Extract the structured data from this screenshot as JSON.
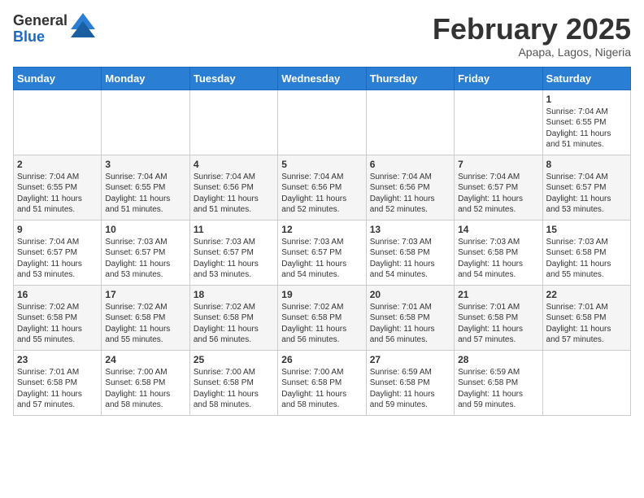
{
  "header": {
    "logo_general": "General",
    "logo_blue": "Blue",
    "month_title": "February 2025",
    "subtitle": "Apapa, Lagos, Nigeria"
  },
  "weekdays": [
    "Sunday",
    "Monday",
    "Tuesday",
    "Wednesday",
    "Thursday",
    "Friday",
    "Saturday"
  ],
  "weeks": [
    [
      {
        "day": "",
        "info": ""
      },
      {
        "day": "",
        "info": ""
      },
      {
        "day": "",
        "info": ""
      },
      {
        "day": "",
        "info": ""
      },
      {
        "day": "",
        "info": ""
      },
      {
        "day": "",
        "info": ""
      },
      {
        "day": "1",
        "info": "Sunrise: 7:04 AM\nSunset: 6:55 PM\nDaylight: 11 hours\nand 51 minutes."
      }
    ],
    [
      {
        "day": "2",
        "info": "Sunrise: 7:04 AM\nSunset: 6:55 PM\nDaylight: 11 hours\nand 51 minutes."
      },
      {
        "day": "3",
        "info": "Sunrise: 7:04 AM\nSunset: 6:55 PM\nDaylight: 11 hours\nand 51 minutes."
      },
      {
        "day": "4",
        "info": "Sunrise: 7:04 AM\nSunset: 6:56 PM\nDaylight: 11 hours\nand 51 minutes."
      },
      {
        "day": "5",
        "info": "Sunrise: 7:04 AM\nSunset: 6:56 PM\nDaylight: 11 hours\nand 52 minutes."
      },
      {
        "day": "6",
        "info": "Sunrise: 7:04 AM\nSunset: 6:56 PM\nDaylight: 11 hours\nand 52 minutes."
      },
      {
        "day": "7",
        "info": "Sunrise: 7:04 AM\nSunset: 6:57 PM\nDaylight: 11 hours\nand 52 minutes."
      },
      {
        "day": "8",
        "info": "Sunrise: 7:04 AM\nSunset: 6:57 PM\nDaylight: 11 hours\nand 53 minutes."
      }
    ],
    [
      {
        "day": "9",
        "info": "Sunrise: 7:04 AM\nSunset: 6:57 PM\nDaylight: 11 hours\nand 53 minutes."
      },
      {
        "day": "10",
        "info": "Sunrise: 7:03 AM\nSunset: 6:57 PM\nDaylight: 11 hours\nand 53 minutes."
      },
      {
        "day": "11",
        "info": "Sunrise: 7:03 AM\nSunset: 6:57 PM\nDaylight: 11 hours\nand 53 minutes."
      },
      {
        "day": "12",
        "info": "Sunrise: 7:03 AM\nSunset: 6:57 PM\nDaylight: 11 hours\nand 54 minutes."
      },
      {
        "day": "13",
        "info": "Sunrise: 7:03 AM\nSunset: 6:58 PM\nDaylight: 11 hours\nand 54 minutes."
      },
      {
        "day": "14",
        "info": "Sunrise: 7:03 AM\nSunset: 6:58 PM\nDaylight: 11 hours\nand 54 minutes."
      },
      {
        "day": "15",
        "info": "Sunrise: 7:03 AM\nSunset: 6:58 PM\nDaylight: 11 hours\nand 55 minutes."
      }
    ],
    [
      {
        "day": "16",
        "info": "Sunrise: 7:02 AM\nSunset: 6:58 PM\nDaylight: 11 hours\nand 55 minutes."
      },
      {
        "day": "17",
        "info": "Sunrise: 7:02 AM\nSunset: 6:58 PM\nDaylight: 11 hours\nand 55 minutes."
      },
      {
        "day": "18",
        "info": "Sunrise: 7:02 AM\nSunset: 6:58 PM\nDaylight: 11 hours\nand 56 minutes."
      },
      {
        "day": "19",
        "info": "Sunrise: 7:02 AM\nSunset: 6:58 PM\nDaylight: 11 hours\nand 56 minutes."
      },
      {
        "day": "20",
        "info": "Sunrise: 7:01 AM\nSunset: 6:58 PM\nDaylight: 11 hours\nand 56 minutes."
      },
      {
        "day": "21",
        "info": "Sunrise: 7:01 AM\nSunset: 6:58 PM\nDaylight: 11 hours\nand 57 minutes."
      },
      {
        "day": "22",
        "info": "Sunrise: 7:01 AM\nSunset: 6:58 PM\nDaylight: 11 hours\nand 57 minutes."
      }
    ],
    [
      {
        "day": "23",
        "info": "Sunrise: 7:01 AM\nSunset: 6:58 PM\nDaylight: 11 hours\nand 57 minutes."
      },
      {
        "day": "24",
        "info": "Sunrise: 7:00 AM\nSunset: 6:58 PM\nDaylight: 11 hours\nand 58 minutes."
      },
      {
        "day": "25",
        "info": "Sunrise: 7:00 AM\nSunset: 6:58 PM\nDaylight: 11 hours\nand 58 minutes."
      },
      {
        "day": "26",
        "info": "Sunrise: 7:00 AM\nSunset: 6:58 PM\nDaylight: 11 hours\nand 58 minutes."
      },
      {
        "day": "27",
        "info": "Sunrise: 6:59 AM\nSunset: 6:58 PM\nDaylight: 11 hours\nand 59 minutes."
      },
      {
        "day": "28",
        "info": "Sunrise: 6:59 AM\nSunset: 6:58 PM\nDaylight: 11 hours\nand 59 minutes."
      },
      {
        "day": "",
        "info": ""
      }
    ]
  ]
}
